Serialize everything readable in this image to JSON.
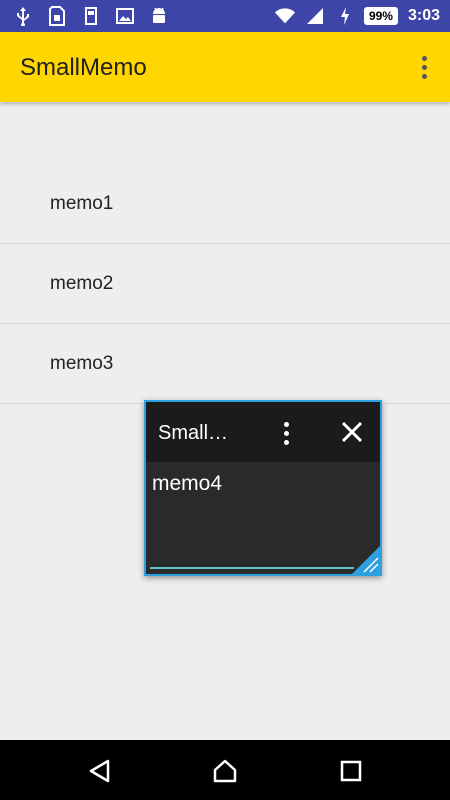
{
  "status_bar": {
    "battery": "99%",
    "time": "3:03",
    "left_icons": [
      "usb-icon",
      "sim-icon",
      "storage-icon",
      "image-icon",
      "android-icon"
    ],
    "right_icons": [
      "wifi-icon",
      "cellular-signal-icon",
      "battery-charging-icon"
    ]
  },
  "app_bar": {
    "title": "SmallMemo",
    "color": "#ffd600",
    "menu_icon": "more-vert-icon"
  },
  "memos": [
    {
      "label": "memo1"
    },
    {
      "label": "memo2"
    },
    {
      "label": "memo3"
    }
  ],
  "floating_window": {
    "title": "Small…",
    "content": "memo4",
    "menu_icon": "more-vert-icon",
    "close_icon": "close-icon",
    "border_color": "#2e9fe0"
  },
  "nav_bar": {
    "buttons": [
      "back-icon",
      "home-icon",
      "recents-icon"
    ]
  }
}
